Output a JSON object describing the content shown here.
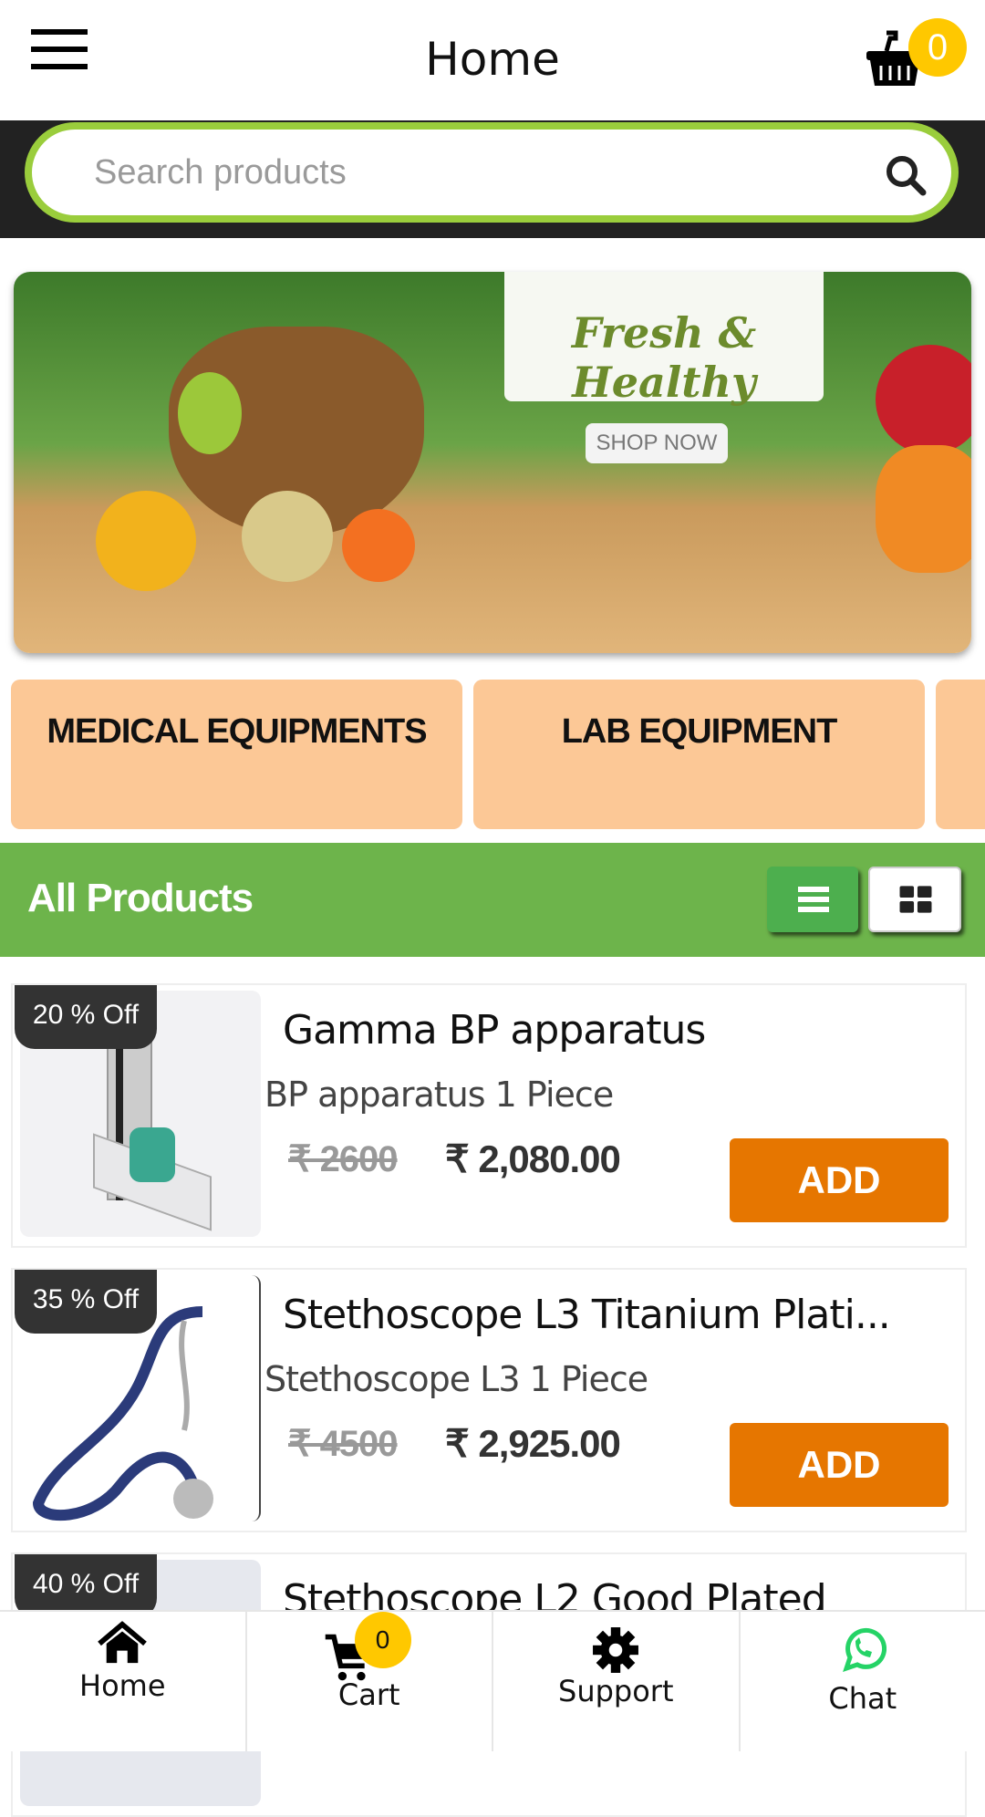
{
  "header": {
    "title": "Home",
    "cart_count": "0"
  },
  "search": {
    "placeholder": "Search products"
  },
  "banner": {
    "headline": "Fresh & Healthy",
    "cta": "SHOP NOW"
  },
  "categories": [
    {
      "label": "MEDICAL EQUIPMENTS"
    },
    {
      "label": "LAB EQUIPMENT"
    },
    {
      "label": ""
    }
  ],
  "section": {
    "title": "All Products",
    "view": "list"
  },
  "products": [
    {
      "discount": "20 % Off",
      "name": "Gamma BP apparatus",
      "subtitle": "BP apparatus 1 Piece",
      "mrp": "₹ 2600",
      "price": "₹ 2,080.00",
      "add": "ADD"
    },
    {
      "discount": "35 % Off",
      "name": "Stethoscope L3 Titanium Plati...",
      "subtitle": "Stethoscope L3 1 Piece",
      "mrp": "₹ 4500",
      "price": "₹ 2,925.00",
      "add": "ADD"
    },
    {
      "discount": "40 % Off",
      "name": "Stethoscope L2 Good Plated"
    }
  ],
  "bottom_nav": [
    {
      "label": "Home",
      "icon": "home-icon"
    },
    {
      "label": "Cart",
      "icon": "cart-icon",
      "badge": "0"
    },
    {
      "label": "Support",
      "icon": "gear-icon"
    },
    {
      "label": "Chat",
      "icon": "whatsapp-icon"
    }
  ],
  "colors": {
    "accent_green": "#6db44b",
    "search_border": "#9acd3c",
    "add_button": "#e67600",
    "badge": "#ffc800",
    "category_bg": "#fcc896"
  }
}
